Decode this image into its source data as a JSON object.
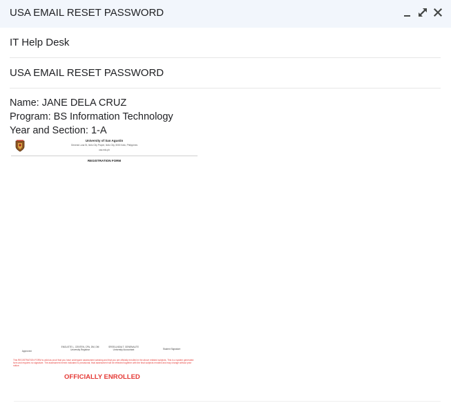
{
  "window": {
    "title": "USA EMAIL RESET PASSWORD",
    "buttons": [
      "minimize-icon",
      "pop-out-icon",
      "close-icon"
    ]
  },
  "compose": {
    "to": "IT Help Desk",
    "subject": "USA EMAIL RESET PASSWORD",
    "body_lines": [
      "Name: JANE DELA CRUZ",
      "Program: BS Information Technology",
      "Year and Section: 1-A"
    ]
  },
  "attachment": {
    "school": "University of San Agustin",
    "address": "General Luna St, Iloilo City Proper, Iloilo City, 5000 Iloilo, Philippines",
    "site": "usa.edu.ph",
    "form_title": "REGISTRATION FORM",
    "approved_label": "Approved:",
    "registrar_name": "ENGLISTE L. CENTEN, CPA, DM, DM",
    "registrar_title": "University Registrar",
    "accountant_name": "SREELLNDIA T. GENENAUTE",
    "accountant_title": "University Accountant",
    "student_signature": "Student Signature",
    "note": "This REGISTRATION FORM is valid as proof that you have undergone assessment advising and that you are officially enrolled in the above enlisted subjects. This is a system generated form and requires no signature. The assessment herein indicated is provisional, final assessment will be reflected together with the final subjects enrolled and may change without prior notice.",
    "status": "OFFICIALLY ENROLLED"
  }
}
